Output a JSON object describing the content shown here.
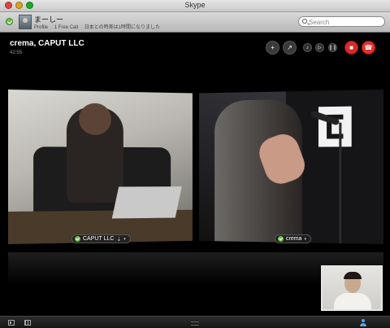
{
  "window": {
    "title": "Skype"
  },
  "profile": {
    "name": "まーしー",
    "links": [
      "Profile",
      "1 Free Call"
    ],
    "mood": "日本との時差は1時間になりました"
  },
  "search": {
    "placeholder": "Search"
  },
  "call": {
    "title": "crema, CAPUT LLC",
    "timer": "42:55"
  },
  "participants": [
    {
      "name": "CAPUT LLC",
      "extra": "⇣",
      "caret": "▾"
    },
    {
      "name": "crema",
      "caret": "▾"
    }
  ],
  "colors": {
    "online": "#6cc04a",
    "hangup": "#e0332f",
    "accent": "#4ea6e6"
  },
  "icons": [
    "add-person-icon",
    "share-screen-icon",
    "mute-mic-icon",
    "volume-icon",
    "pause-icon",
    "video-icon",
    "hangup-icon",
    "dialpad-icon",
    "sidebar-toggle-icon",
    "contacts-icon"
  ]
}
